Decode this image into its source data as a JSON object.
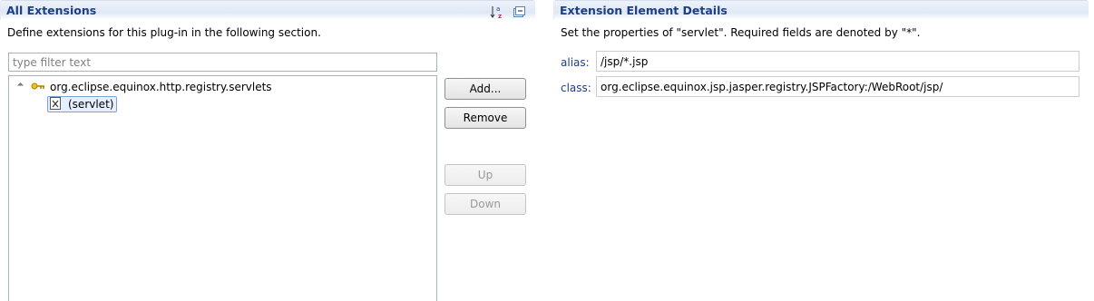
{
  "left_section": {
    "title": "All Extensions",
    "description": "Define extensions for this plug-in in the following section.",
    "filter_placeholder": "type filter text",
    "tree": {
      "extension_label": "org.eclipse.equinox.http.registry.servlets",
      "element_label": "(servlet)"
    },
    "buttons": {
      "add": "Add...",
      "remove": "Remove",
      "up": "Up",
      "down": "Down"
    },
    "tools": [
      "sort-alphabetical-icon",
      "collapse-all-icon"
    ]
  },
  "right_section": {
    "title": "Extension Element Details",
    "description": "Set the properties of \"servlet\". Required fields are denoted by \"*\".",
    "fields": {
      "alias_label": "alias:",
      "alias_value": "/jsp/*.jsp",
      "class_label": "class:",
      "class_value": "org.eclipse.equinox.jsp.jasper.registry.JSPFactory:/WebRoot/jsp/"
    }
  },
  "colors": {
    "header_title": "#1c3f83",
    "field_label": "#1c3f83",
    "selection_bg": "#e5efff",
    "selection_border": "#7da2ce"
  }
}
